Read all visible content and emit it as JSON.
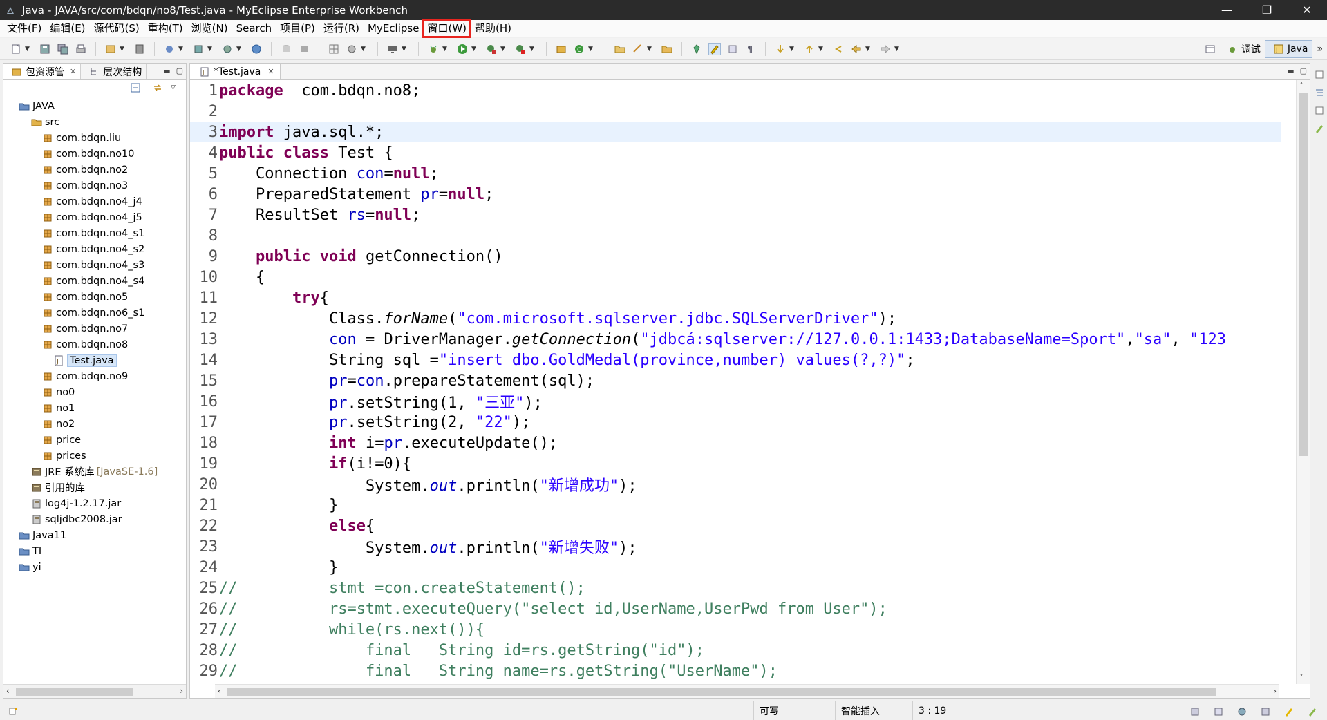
{
  "window": {
    "title": "Java - JAVA/src/com/bdqn/no8/Test.java - MyEclipse Enterprise Workbench",
    "controls": [
      "—",
      "❐",
      "✕"
    ]
  },
  "menu": {
    "items": [
      "文件(F)",
      "编辑(E)",
      "源代码(S)",
      "重构(T)",
      "浏览(N)",
      "Search",
      "项目(P)",
      "运行(R)",
      "MyEclipse",
      "窗口(W)",
      "帮助(H)"
    ]
  },
  "toolbar": {
    "perspectives": [
      "调试",
      "Java"
    ],
    "overflow": "»"
  },
  "left_panel": {
    "tabs": [
      {
        "label": "包资源管",
        "close": "✕"
      },
      {
        "label": "层次结构"
      }
    ],
    "tree": [
      {
        "label": "JAVA",
        "level": 0,
        "icon": "project-icon"
      },
      {
        "label": "src",
        "level": 1,
        "icon": "source-folder-icon"
      },
      {
        "label": "com.bdqn.liu",
        "level": 2,
        "icon": "package-icon"
      },
      {
        "label": "com.bdqn.no10",
        "level": 2,
        "icon": "package-icon"
      },
      {
        "label": "com.bdqn.no2",
        "level": 2,
        "icon": "package-icon"
      },
      {
        "label": "com.bdqn.no3",
        "level": 2,
        "icon": "package-icon"
      },
      {
        "label": "com.bdqn.no4_j4",
        "level": 2,
        "icon": "package-icon"
      },
      {
        "label": "com.bdqn.no4_j5",
        "level": 2,
        "icon": "package-icon"
      },
      {
        "label": "com.bdqn.no4_s1",
        "level": 2,
        "icon": "package-icon"
      },
      {
        "label": "com.bdqn.no4_s2",
        "level": 2,
        "icon": "package-icon"
      },
      {
        "label": "com.bdqn.no4_s3",
        "level": 2,
        "icon": "package-icon"
      },
      {
        "label": "com.bdqn.no4_s4",
        "level": 2,
        "icon": "package-icon"
      },
      {
        "label": "com.bdqn.no5",
        "level": 2,
        "icon": "package-icon"
      },
      {
        "label": "com.bdqn.no6_s1",
        "level": 2,
        "icon": "package-icon"
      },
      {
        "label": "com.bdqn.no7",
        "level": 2,
        "icon": "package-icon"
      },
      {
        "label": "com.bdqn.no8",
        "level": 2,
        "icon": "package-icon"
      },
      {
        "label": "Test.java",
        "level": 3,
        "icon": "java-file-icon",
        "selected": true
      },
      {
        "label": "com.bdqn.no9",
        "level": 2,
        "icon": "package-icon"
      },
      {
        "label": "no0",
        "level": 2,
        "icon": "package-icon"
      },
      {
        "label": "no1",
        "level": 2,
        "icon": "package-icon"
      },
      {
        "label": "no2",
        "level": 2,
        "icon": "package-icon"
      },
      {
        "label": "price",
        "level": 2,
        "icon": "package-icon"
      },
      {
        "label": "prices",
        "level": 2,
        "icon": "package-icon"
      },
      {
        "label": "JRE 系统库",
        "suffix": "[JavaSE-1.6]",
        "level": 1,
        "icon": "library-icon"
      },
      {
        "label": "引用的库",
        "level": 1,
        "icon": "library-icon"
      },
      {
        "label": "log4j-1.2.17.jar",
        "level": 1,
        "icon": "jar-icon"
      },
      {
        "label": "sqljdbc2008.jar",
        "level": 1,
        "icon": "jar-icon"
      },
      {
        "label": "Java11",
        "level": 0,
        "icon": "project-icon"
      },
      {
        "label": "TI",
        "level": 0,
        "icon": "project-icon"
      },
      {
        "label": "yi",
        "level": 0,
        "icon": "project-icon"
      }
    ]
  },
  "editor": {
    "tab_label": "*Test.java",
    "current_line": 3,
    "lines": [
      {
        "n": "1",
        "segs": [
          [
            "kw",
            "package"
          ],
          [
            "",
            "  com.bdqn.no8;"
          ]
        ]
      },
      {
        "n": "2",
        "segs": []
      },
      {
        "n": "3",
        "segs": [
          [
            "kw",
            "import"
          ],
          [
            "",
            " java.sql.*;"
          ]
        ]
      },
      {
        "n": "4",
        "segs": [
          [
            "kw",
            "public"
          ],
          [
            "",
            " "
          ],
          [
            "kw",
            "class"
          ],
          [
            "",
            " Test {"
          ]
        ]
      },
      {
        "n": "5",
        "segs": [
          [
            "",
            "    Connection "
          ],
          [
            "fld",
            "con"
          ],
          [
            "",
            "="
          ],
          [
            "kw",
            "null"
          ],
          [
            "",
            ";"
          ]
        ]
      },
      {
        "n": "6",
        "segs": [
          [
            "",
            "    PreparedStatement "
          ],
          [
            "fld",
            "pr"
          ],
          [
            "",
            "="
          ],
          [
            "kw",
            "null"
          ],
          [
            "",
            ";"
          ]
        ]
      },
      {
        "n": "7",
        "segs": [
          [
            "",
            "    ResultSet "
          ],
          [
            "fld",
            "rs"
          ],
          [
            "",
            "="
          ],
          [
            "kw",
            "null"
          ],
          [
            "",
            ";"
          ]
        ]
      },
      {
        "n": "8",
        "segs": []
      },
      {
        "n": "9",
        "segs": [
          [
            "",
            "    "
          ],
          [
            "kw",
            "public"
          ],
          [
            "",
            " "
          ],
          [
            "kw",
            "void"
          ],
          [
            "",
            " getConnection()"
          ]
        ]
      },
      {
        "n": "10",
        "segs": [
          [
            "",
            "    {"
          ]
        ]
      },
      {
        "n": "11",
        "segs": [
          [
            "",
            "        "
          ],
          [
            "kw",
            "try"
          ],
          [
            "",
            "{"
          ]
        ]
      },
      {
        "n": "12",
        "segs": [
          [
            "",
            "            Class."
          ],
          [
            "ital",
            "forName"
          ],
          [
            "",
            "("
          ],
          [
            "str",
            "\"com.microsoft.sqlserver.jdbc.SQLServerDriver\""
          ],
          [
            "",
            ");"
          ]
        ]
      },
      {
        "n": "13",
        "segs": [
          [
            "",
            "            "
          ],
          [
            "fld",
            "con"
          ],
          [
            "",
            " = DriverManager."
          ],
          [
            "ital",
            "getConnection"
          ],
          [
            "",
            "("
          ],
          [
            "str",
            "\"jdbcá:sqlserver://127.0.0.1:1433;DatabaseName=Sport\""
          ],
          [
            "",
            ","
          ],
          [
            "str",
            "\"sa\""
          ],
          [
            "",
            ", "
          ],
          [
            "str",
            "\"123"
          ]
        ]
      },
      {
        "n": "14",
        "segs": [
          [
            "",
            "            String sql ="
          ],
          [
            "str",
            "\"insert dbo.GoldMedal(province,number) values(?,?)\""
          ],
          [
            "",
            ";"
          ]
        ]
      },
      {
        "n": "15",
        "segs": [
          [
            "",
            "            "
          ],
          [
            "fld",
            "pr"
          ],
          [
            "",
            "="
          ],
          [
            "fld",
            "con"
          ],
          [
            "",
            ".prepareStatement(sql);"
          ]
        ]
      },
      {
        "n": "16",
        "segs": [
          [
            "",
            "            "
          ],
          [
            "fld",
            "pr"
          ],
          [
            "",
            ".setString(1, "
          ],
          [
            "str",
            "\"三亚\""
          ],
          [
            "",
            ");"
          ]
        ]
      },
      {
        "n": "17",
        "segs": [
          [
            "",
            "            "
          ],
          [
            "fld",
            "pr"
          ],
          [
            "",
            ".setString(2, "
          ],
          [
            "str",
            "\"22\""
          ],
          [
            "",
            ");"
          ]
        ]
      },
      {
        "n": "18",
        "segs": [
          [
            "",
            "            "
          ],
          [
            "kw",
            "int"
          ],
          [
            "",
            " i="
          ],
          [
            "fld",
            "pr"
          ],
          [
            "",
            ".executeUpdate();"
          ]
        ]
      },
      {
        "n": "19",
        "segs": [
          [
            "",
            "            "
          ],
          [
            "kw",
            "if"
          ],
          [
            "",
            "(i!=0){"
          ]
        ]
      },
      {
        "n": "20",
        "segs": [
          [
            "",
            "                System."
          ],
          [
            "fld ital",
            "out"
          ],
          [
            "",
            ".println("
          ],
          [
            "str",
            "\"新增成功\""
          ],
          [
            "",
            ");"
          ]
        ]
      },
      {
        "n": "21",
        "segs": [
          [
            "",
            "            }"
          ]
        ]
      },
      {
        "n": "22",
        "segs": [
          [
            "",
            "            "
          ],
          [
            "kw",
            "else"
          ],
          [
            "",
            "{"
          ]
        ]
      },
      {
        "n": "23",
        "segs": [
          [
            "",
            "                System."
          ],
          [
            "fld ital",
            "out"
          ],
          [
            "",
            ".println("
          ],
          [
            "str",
            "\"新增失败\""
          ],
          [
            "",
            ");"
          ]
        ]
      },
      {
        "n": "24",
        "segs": [
          [
            "",
            "            }"
          ]
        ]
      },
      {
        "n": "25",
        "segs": [
          [
            "cmt",
            "//"
          ],
          [
            "",
            "          "
          ],
          [
            "cmt",
            "stmt =con.createStatement();"
          ]
        ]
      },
      {
        "n": "26",
        "segs": [
          [
            "cmt",
            "//"
          ],
          [
            "",
            "          "
          ],
          [
            "cmt",
            "rs=stmt.executeQuery(\"select id,UserName,UserPwd from User\");"
          ]
        ]
      },
      {
        "n": "27",
        "segs": [
          [
            "cmt",
            "//"
          ],
          [
            "",
            "          "
          ],
          [
            "cmt",
            "while(rs.next()){"
          ]
        ]
      },
      {
        "n": "28",
        "segs": [
          [
            "cmt",
            "//"
          ],
          [
            "",
            "              "
          ],
          [
            "cmt",
            "final   String id=rs.getString(\"id\");"
          ]
        ]
      },
      {
        "n": "29",
        "segs": [
          [
            "cmt",
            "//"
          ],
          [
            "",
            "              "
          ],
          [
            "cmt",
            "final   String name=rs.getString(\"UserName\");"
          ]
        ]
      }
    ]
  },
  "statusbar": {
    "mode": "可写",
    "insert": "智能插入",
    "position": "3 : 19"
  },
  "colors": {
    "keyword": "#7f0055",
    "string": "#2a00ff",
    "field": "#0000c0",
    "comment": "#3f7f5f",
    "highlight_box": "#e8251f"
  }
}
